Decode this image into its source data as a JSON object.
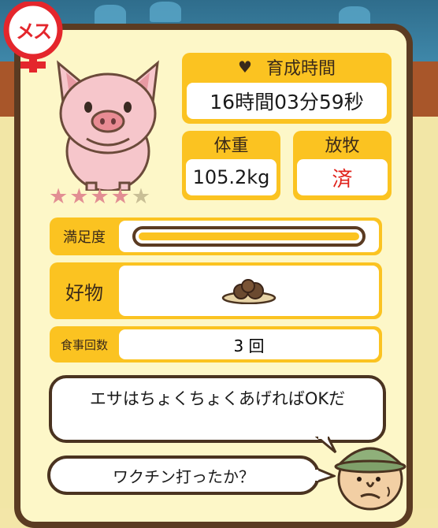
{
  "gender_badge": "メス",
  "growth_time": {
    "label": "育成時間",
    "value": "16時間03分59秒"
  },
  "weight": {
    "label": "体重",
    "value": "105.2kg"
  },
  "grazing": {
    "label": "放牧",
    "value": "済"
  },
  "rating": {
    "filled": 4,
    "total": 5
  },
  "satisfaction": {
    "label": "満足度",
    "level": 1.0
  },
  "favorite_food": {
    "label": "好物",
    "icon": "food-plate-icon"
  },
  "meal_count": {
    "label": "食事回数",
    "value": "3 回"
  },
  "speech_pig": "エサはちょくちょくあげればOKだ",
  "speech_farmer": "ワクチン打ったか？",
  "colors": {
    "frame": "#5b3b22",
    "panel": "#fdf7c8",
    "accent": "#fbc321",
    "grazing_value": "#e0221b"
  }
}
